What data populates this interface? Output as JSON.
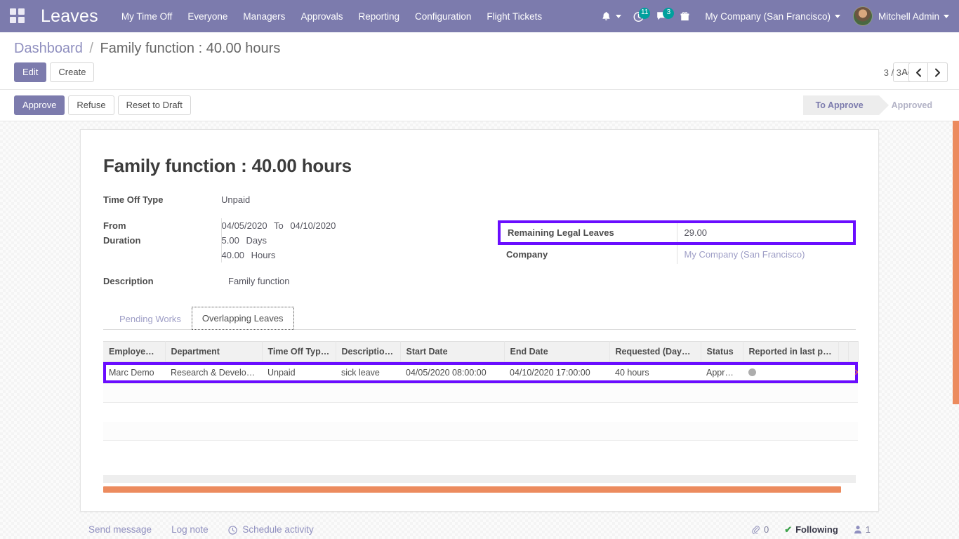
{
  "navbar": {
    "apps_icon": "apps-grid-icon",
    "brand": "Leaves",
    "menu": [
      {
        "label": "My Time Off"
      },
      {
        "label": "Everyone"
      },
      {
        "label": "Managers"
      },
      {
        "label": "Approvals"
      },
      {
        "label": "Reporting"
      },
      {
        "label": "Configuration"
      },
      {
        "label": "Flight Tickets"
      }
    ],
    "bell_icon": "bell-icon",
    "activity_icon": "clock-activity-icon",
    "activity_count": "11",
    "messages_icon": "chat-bubble-icon",
    "messages_count": "3",
    "gift_icon": "gift-icon",
    "company": "My Company (San Francisco)",
    "user": "Mitchell Admin",
    "badge_color": "#00a09d",
    "bg_color": "#7c7bad"
  },
  "control_panel": {
    "breadcrumb_root": "Dashboard",
    "breadcrumb_sep": "/",
    "breadcrumb_current": "Family function : 40.00 hours",
    "edit_label": "Edit",
    "create_label": "Create",
    "action_label": "Action",
    "pager_value": "3 / 3",
    "prev_icon": "chevron-left-icon",
    "next_icon": "chevron-right-icon"
  },
  "status_row": {
    "approve_label": "Approve",
    "refuse_label": "Refuse",
    "reset_label": "Reset to Draft",
    "stages": [
      {
        "label": "To Approve",
        "active": true
      },
      {
        "label": "Approved",
        "active": false
      }
    ]
  },
  "form": {
    "title": "Family function : 40.00 hours",
    "left_fields": [
      {
        "label": "Time Off Type",
        "value": "Unpaid"
      }
    ],
    "from_label": "From",
    "from_value": "04/05/2020",
    "to_word": "To",
    "to_value": "04/10/2020",
    "duration_label": "Duration",
    "duration_days_value": "5.00",
    "duration_days_unit": "Days",
    "duration_hours_value": "40.00",
    "duration_hours_unit": "Hours",
    "description_label": "Description",
    "description_value": "Family function",
    "right_fields": [
      {
        "label": "Remaining Legal Leaves",
        "value": "29.00",
        "highlighted": true
      },
      {
        "label": "Company",
        "value": "My Company (San Francisco)",
        "link": true
      }
    ],
    "highlight_color": "#6a0dff"
  },
  "notebook": {
    "tabs": [
      {
        "label": "Pending Works",
        "active": false
      },
      {
        "label": "Overlapping Leaves",
        "active": true
      }
    ]
  },
  "list": {
    "columns": [
      "Employee…",
      "Department",
      "Time Off Type…",
      "Description…",
      "Start Date",
      "End Date",
      "Requested (Days/…",
      "Status",
      "Reported in last p…"
    ],
    "rows": [
      {
        "employee": "Marc Demo",
        "department": "Research & Develo…",
        "time_off_type": "Unpaid",
        "description": "sick leave",
        "start_date": "04/05/2020 08:00:00",
        "end_date": "04/10/2020 17:00:00",
        "requested": "40 hours",
        "status": "Approved",
        "status_dot": "gray-dot-icon",
        "reported": "",
        "delete_icon": "delete-row-icon",
        "highlighted": true
      }
    ]
  },
  "chatter": {
    "send_message": "Send message",
    "log_note": "Log note",
    "schedule_activity": "Schedule activity",
    "schedule_icon": "clock-icon",
    "attachment_icon": "paperclip-icon",
    "attachment_count": "0",
    "following_label": "Following",
    "follow_check_icon": "check-icon",
    "followers_icon": "user-icon",
    "followers_count": "1"
  },
  "scrollbars": {
    "vertical_color": "#ec8b5e",
    "horizontal_color": "#ec8b5e"
  }
}
